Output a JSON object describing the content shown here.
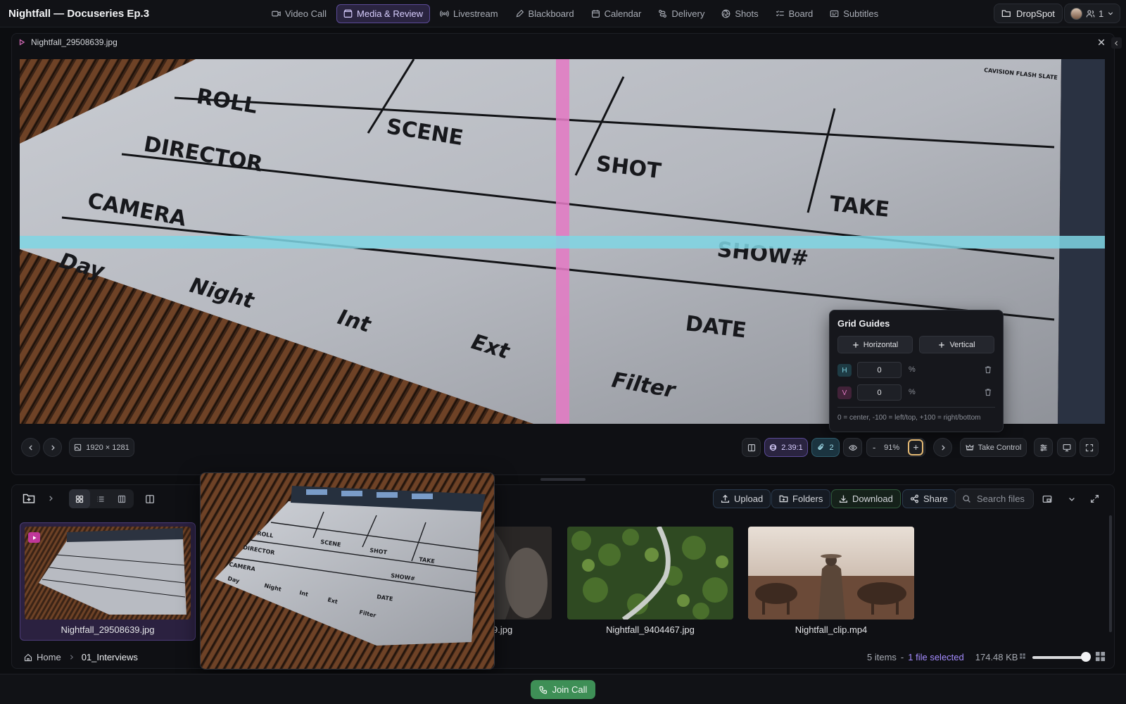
{
  "app": {
    "title": "Nightfall — Docuseries Ep.3"
  },
  "nav": {
    "tabs": [
      {
        "label": "Video Call",
        "icon": "video-icon"
      },
      {
        "label": "Media & Review",
        "icon": "media-icon",
        "active": true
      },
      {
        "label": "Livestream",
        "icon": "broadcast-icon"
      },
      {
        "label": "Blackboard",
        "icon": "pen-icon"
      },
      {
        "label": "Calendar",
        "icon": "calendar-icon"
      },
      {
        "label": "Delivery",
        "icon": "route-icon"
      },
      {
        "label": "Shots",
        "icon": "aperture-icon"
      },
      {
        "label": "Board",
        "icon": "list-check-icon"
      },
      {
        "label": "Subtitles",
        "icon": "captions-icon"
      }
    ],
    "dropspot_label": "DropSpot",
    "user_count": "1"
  },
  "viewer": {
    "filename": "Nightfall_29508639.jpg",
    "dimensions": "1920 × 1281",
    "aspect_ratio": "2.39:1",
    "annotation_count": "2",
    "zoom": "91%",
    "take_control_label": "Take Control",
    "slate_labels": [
      "ROLL",
      "SCENE",
      "SHOT",
      "TAKE",
      "DIRECTOR",
      "CAMERA",
      "SHOW#",
      "Day",
      "Night",
      "Int",
      "Ext",
      "DATE",
      "Filter",
      "CAVISION FLASH SLATE"
    ]
  },
  "grid_guides": {
    "title": "Grid Guides",
    "add_horizontal": "Horizontal",
    "add_vertical": "Vertical",
    "rows": [
      {
        "tag": "H",
        "value": "0",
        "unit": "%"
      },
      {
        "tag": "V",
        "value": "0",
        "unit": "%"
      }
    ],
    "hint": "0 = center, -100 = left/top, +100 = right/bottom",
    "colors": {
      "horizontal": "#7fd6e4",
      "vertical": "#e27bc4"
    }
  },
  "browser": {
    "toolbar": {
      "upload": "Upload",
      "folders": "Folders",
      "download": "Download",
      "share": "Share",
      "search_placeholder": "Search files"
    },
    "files": [
      {
        "name": "Nightfall_29508639.jpg",
        "selected": true
      },
      {
        "name": "9.jpg"
      },
      {
        "name": "Nightfall_9404467.jpg"
      },
      {
        "name": "Nightfall_clip.mp4"
      }
    ],
    "breadcrumb": [
      "Home",
      "01_Interviews"
    ],
    "status": {
      "items": "5 items",
      "separator": "-",
      "selected": "1 file selected",
      "size": "174.48 KB"
    }
  },
  "footer": {
    "join_call": "Join Call"
  },
  "colors": {
    "accent": "#7b61ff",
    "join": "#3e8f56"
  }
}
